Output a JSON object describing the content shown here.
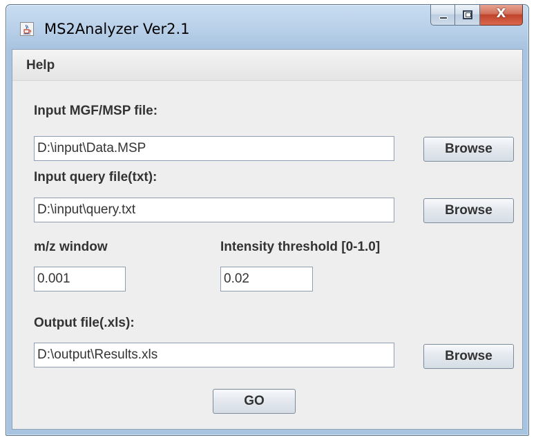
{
  "window": {
    "title": "MS2Analyzer Ver2.1",
    "close_glyph": "X"
  },
  "menu": {
    "help": "Help"
  },
  "form": {
    "input_file_label": "Input MGF/MSP file:",
    "input_file_value": "D:\\input\\Data.MSP",
    "query_file_label": "Input query file(txt):",
    "query_file_value": "D:\\input\\query.txt",
    "mz_window_label": "m/z window",
    "mz_window_value": "0.001",
    "intensity_label": "Intensity threshold [0-1.0]",
    "intensity_value": "0.02",
    "output_file_label": "Output file(.xls):",
    "output_file_value": "D:\\output\\Results.xls",
    "browse_label": "Browse",
    "go_label": "GO"
  },
  "colors": {
    "frame": "#a9c4e0",
    "panel": "#eeeeee",
    "close_button": "#c0432a"
  },
  "icons": {
    "app": "java-cup-icon",
    "minimize": "minimize-icon",
    "maximize": "maximize-icon",
    "close": "close-icon"
  }
}
